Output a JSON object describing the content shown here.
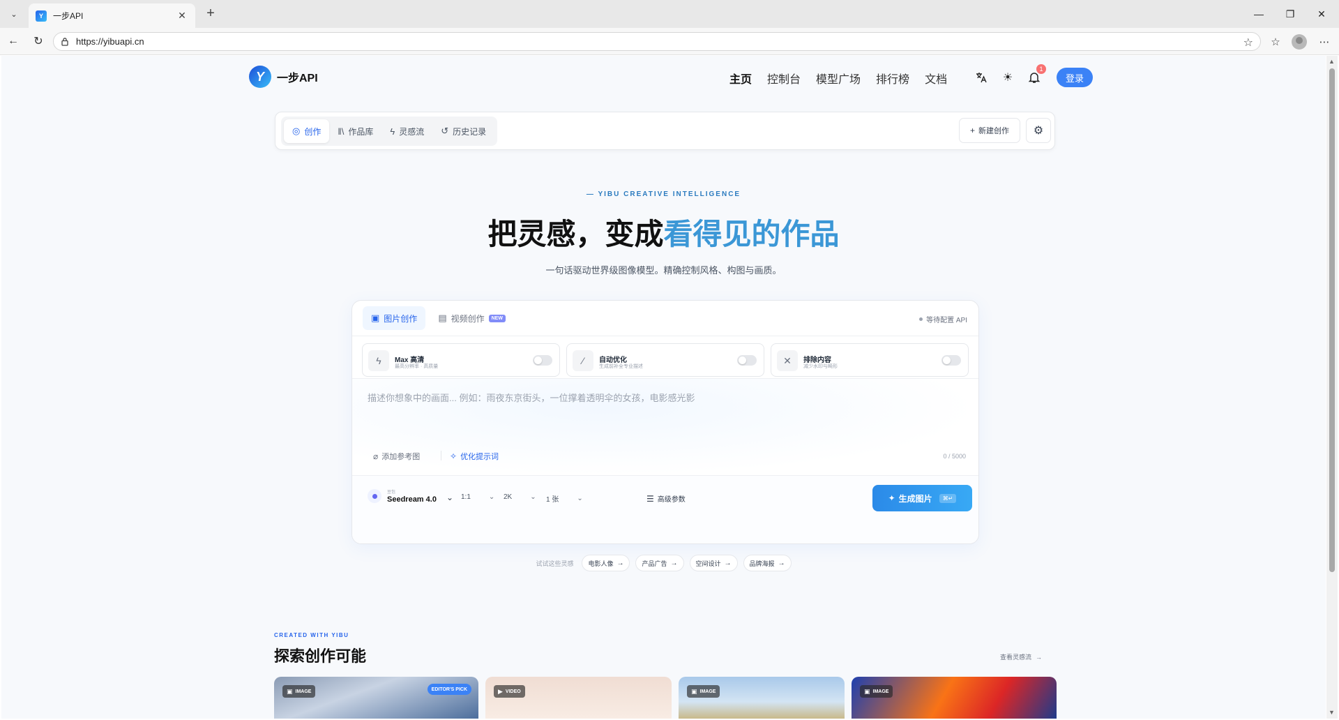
{
  "browser": {
    "tab_title": "一步API",
    "favicon_text": "Y",
    "url": "https://yibuapi.cn"
  },
  "site": {
    "logo_text": "一步API",
    "logo_mark": "Y",
    "nav": [
      "主页",
      "控制台",
      "模型广场",
      "排行榜",
      "文档"
    ],
    "notification_count": "1",
    "login_label": "登录"
  },
  "toolbar": {
    "tabs": [
      "创作",
      "作品库",
      "灵感流",
      "历史记录"
    ],
    "new_create_label": "新建创作"
  },
  "hero": {
    "kicker": "— YIBU CREATIVE INTELLIGENCE",
    "title_plain": "把灵感，变成",
    "title_accent": "看得见的作品",
    "subtitle": "一句话驱动世界级图像模型。精确控制风格、构图与画质。"
  },
  "composer": {
    "tab_image": "图片创作",
    "tab_video": "视频创作",
    "new_badge": "NEW",
    "api_status": "等待配置 API",
    "options": [
      {
        "title": "Max 高清",
        "desc": "最高分辨率 · 高质量",
        "icon": "lightning-icon"
      },
      {
        "title": "自动优化",
        "desc": "生成前补全专业描述",
        "icon": "magic-wand-icon"
      },
      {
        "title": "排除内容",
        "desc": "减少水印与畸形",
        "icon": "close-icon"
      }
    ],
    "prompt_placeholder": "描述你想象中的画面... 例如：雨夜东京街头，一位撑着透明伞的女孩，电影感光影",
    "add_ref_label": "添加参考图",
    "optimize_label": "优化提示词",
    "char_count": "0 / 5000",
    "model_vendor": "豆包",
    "model_name": "Seedream 4.0",
    "ratio": "1:1",
    "resolution": "2K",
    "count": "1 张",
    "advanced_label": "高级参数",
    "generate_label": "生成图片",
    "shortcut": "⌘↵"
  },
  "suggestions": {
    "label": "试试这些灵感",
    "chips": [
      "电影人像",
      "产品广告",
      "空间设计",
      "品牌海报"
    ]
  },
  "gallery": {
    "kicker": "CREATED WITH YIBU",
    "title": "探索创作可能",
    "more_label": "查看灵感流",
    "cards": [
      {
        "type": "IMAGE",
        "badge": "EDITOR'S PICK"
      },
      {
        "type": "VIDEO"
      },
      {
        "type": "IMAGE"
      },
      {
        "type": "IMAGE"
      }
    ]
  }
}
